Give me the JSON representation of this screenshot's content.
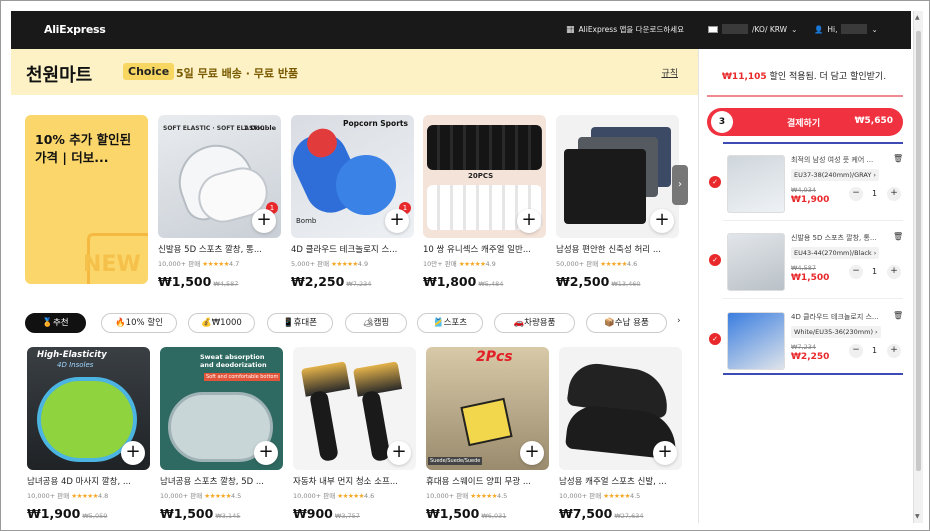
{
  "topbar": {
    "logo": "AliExpress",
    "app_download": "AliExpress 앱을 다운로드하세요",
    "locale": "/KO/ KRW",
    "greeting": "Hi,"
  },
  "banner": {
    "title": "천원마트",
    "choice": "Choice",
    "subtitle": "5일 무료 배송 · 무료 반품",
    "rules_link": "규칙"
  },
  "promo": {
    "text": "10% 추가 할인된 가격 | 더보...",
    "new_label": "NEW"
  },
  "top_products": [
    {
      "title": "신발용 5D 스포츠 깔창, 통...",
      "sold": "10,000+ 판매",
      "rating": "4.7",
      "price": "₩1,500",
      "old_price": "₩4,587",
      "badge": "1",
      "img_text": "SOFT ELASTIC · SOFT ELASTIC",
      "img_text2": "1 Double"
    },
    {
      "title": "4D 클라우드 테크놀로지 스...",
      "sold": "5,000+ 판매",
      "rating": "4.9",
      "price": "₩2,250",
      "old_price": "₩7,234",
      "badge": "1",
      "img_text": "Popcorn Sports",
      "img_text2": "Bomb"
    },
    {
      "title": "10 쌍 유니섹스 캐주얼 일반...",
      "sold": "10만+ 판매",
      "rating": "4.9",
      "price": "₩1,800",
      "old_price": "₩5,484",
      "badge": "",
      "img_text": "20PCS",
      "img_text2": ""
    },
    {
      "title": "남성용 편안한 신축성 허리 ...",
      "sold": "50,000+ 판매",
      "rating": "4.6",
      "price": "₩2,500",
      "old_price": "₩13,460",
      "badge": "",
      "img_text": "",
      "img_text2": ""
    }
  ],
  "chips": [
    {
      "label": "추천",
      "icon": "🏅"
    },
    {
      "label": "10% 할인",
      "icon": "🔥"
    },
    {
      "label": "₩1000",
      "icon": "💰"
    },
    {
      "label": "휴대폰",
      "icon": "📱"
    },
    {
      "label": "캠핑",
      "icon": "🏕"
    },
    {
      "label": "스포츠",
      "icon": "🎽"
    },
    {
      "label": "차량용품",
      "icon": "🚗"
    },
    {
      "label": "수납 용품",
      "icon": "📦"
    }
  ],
  "bottom_products": [
    {
      "title": "남녀공용 4D 마사지 깔창, ...",
      "sold": "10,000+ 판매",
      "rating": "4.8",
      "price": "₩1,900",
      "old_price": "₩5,059",
      "img_text": "High-Elasticity",
      "img_text2": "4D Insoles"
    },
    {
      "title": "남녀공용 스포츠 깔창, 5D ...",
      "sold": "10,000+ 판매",
      "rating": "4.5",
      "price": "₩1,500",
      "old_price": "₩3,145",
      "img_text": "Sweat absorption and deodorization",
      "img_text2": "Soft and comfortable bottom"
    },
    {
      "title": "자동차 내부 먼지 청소 소프...",
      "sold": "10,000+ 판매",
      "rating": "4.6",
      "price": "₩900",
      "old_price": "₩3,757",
      "img_text": "",
      "img_text2": ""
    },
    {
      "title": "휴대용 스웨이드 양피 무광 ...",
      "sold": "10,000+ 판매",
      "rating": "4.5",
      "price": "₩1,500",
      "old_price": "₩6,031",
      "img_text": "2Pcs",
      "img_text2": "Suede/Suede/Suede"
    },
    {
      "title": "남성용 캐주얼 스포츠 신발, ...",
      "sold": "10,000+ 판매",
      "rating": "4.5",
      "price": "₩7,500",
      "old_price": "₩27,634",
      "img_text": "",
      "img_text2": ""
    }
  ],
  "cart": {
    "headline_amount": "₩11,105",
    "headline_rest": " 할인 적용됨. 더 담고 할인받기.",
    "count": "3",
    "checkout_label": "결제하기",
    "checkout_price": "₩5,650",
    "items": [
      {
        "title": "최적의 남성 여성 풋 케어 ...",
        "variant": "EU37-38(240mm)/GRAY",
        "old_price": "₩4,934",
        "price": "₩1,900",
        "qty": "1"
      },
      {
        "title": "신발용 5D 스포츠 깔창, 통...",
        "variant": "EU43-44(270mm)/Black",
        "old_price": "₩4,587",
        "price": "₩1,500",
        "qty": "1"
      },
      {
        "title": "4D 클라우드 테크놀로지 스...",
        "variant": "White/EU35-36(230mm)",
        "old_price": "₩7,234",
        "price": "₩2,250",
        "qty": "1"
      }
    ]
  }
}
